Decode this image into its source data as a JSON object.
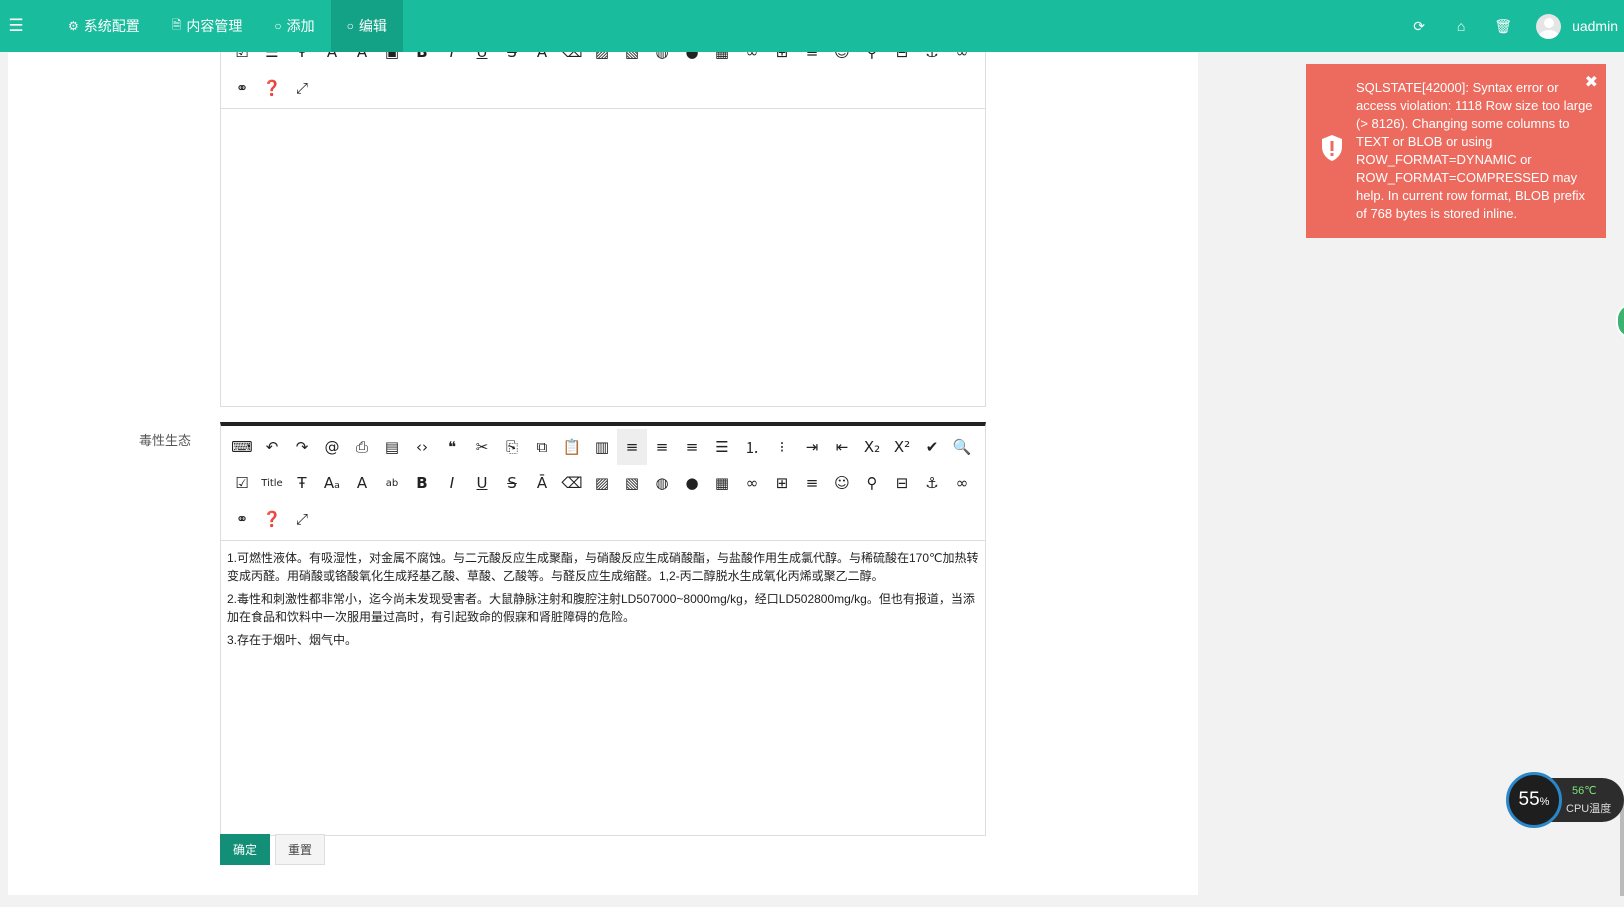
{
  "topbar": {
    "nav": [
      {
        "icon": "gear-icon",
        "label": "系统配置"
      },
      {
        "icon": "file-icon",
        "label": "内容管理"
      },
      {
        "icon": "circle-icon",
        "label": "添加"
      },
      {
        "icon": "circle-icon",
        "label": "编辑"
      }
    ],
    "active_index": 3,
    "right_icons": [
      "refresh-icon",
      "home-icon",
      "trash-icon"
    ],
    "username": "uadmin"
  },
  "form": {
    "field_label": "毒性生态",
    "editor_content": [
      "1.可燃性液体。有吸湿性，对金属不腐蚀。与二元酸反应生成聚酯，与硝酸反应生成硝酸酯，与盐酸作用生成氯代醇。与稀硫酸在170℃加热转变成丙醛。用硝酸或铬酸氧化生成羟基乙酸、草酸、乙酸等。与醛反应生成缩醛。1,2-丙二醇脱水生成氧化丙烯或聚乙二醇。",
      "2.毒性和刺激性都非常小，迄今尚未发现受害者。大鼠静脉注射和腹腔注射LD507000~8000mg/kg，经口LD502800mg/kg。但也有报道，当添加在食品和饮料中一次服用量过高时，有引起致命的假寐和肾脏障碍的危险。",
      "3.存在于烟叶、烟气中。"
    ],
    "submit_label": "确定",
    "reset_label": "重置"
  },
  "toast": {
    "message": "SQLSTATE[42000]: Syntax error or access violation: 1118 Row size too large (> 8126). Changing some columns to TEXT or BLOB or using ROW_FORMAT=DYNAMIC or ROW_FORMAT=COMPRESSED may help. In current row format, BLOB prefix of 768 bytes is stored inline.",
    "close": "✖",
    "color": "#ec6b5e"
  },
  "cpu_widget": {
    "usage": "55",
    "usage_unit": "%",
    "temp": "56℃",
    "label": "CPU温度"
  },
  "colors": {
    "topbar": "#19bc9c",
    "primary_button": "#148f77"
  },
  "toolbar_icons_row1": [
    "source-icon",
    "undo-icon",
    "redo-icon",
    "at-icon",
    "print-icon",
    "preview-icon",
    "code-icon",
    "quote-icon",
    "cut-icon",
    "copy-icon",
    "copy-format-icon",
    "paste-icon",
    "paste-word-icon",
    "align-left-icon",
    "align-center-icon",
    "align-right-icon",
    "justify-icon",
    "ordered-list-icon",
    "unordered-list-icon",
    "indent-icon",
    "outdent-icon",
    "subscript-icon",
    "superscript-icon",
    "clear-format-icon",
    "find-icon"
  ],
  "toolbar_icons_row2": [
    "select-all-icon",
    "title-icon",
    "font-family-icon",
    "font-size-icon",
    "font-color-icon",
    "highlight-icon",
    "bold-icon",
    "italic-icon",
    "underline-icon",
    "strikethrough-icon",
    "line-height-icon",
    "eraser-icon",
    "image-icon",
    "multi-image-icon",
    "flash-icon",
    "media-icon",
    "video-icon",
    "link-icon",
    "table-icon",
    "hr-icon",
    "emoticon-icon",
    "map-icon",
    "pagebreak-icon",
    "anchor-icon",
    "unlink-icon"
  ],
  "toolbar_icons_row3": [
    "unlink-all-icon",
    "help-icon",
    "fullscreen-icon"
  ]
}
